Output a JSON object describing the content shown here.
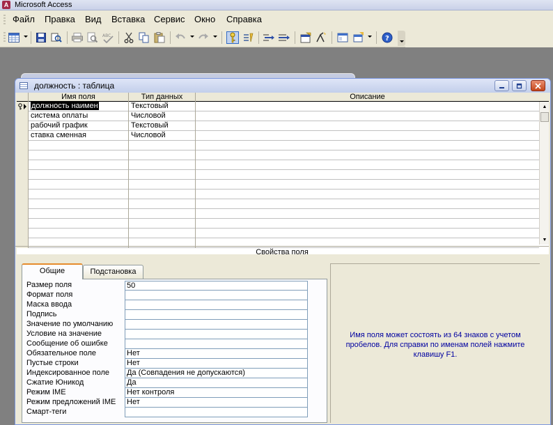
{
  "app": {
    "title": "Microsoft Access",
    "icon": "access-app-icon"
  },
  "menu": [
    {
      "label": "Файл"
    },
    {
      "label": "Правка"
    },
    {
      "label": "Вид"
    },
    {
      "label": "Вставка"
    },
    {
      "label": "Сервис"
    },
    {
      "label": "Окно"
    },
    {
      "label": "Справка"
    }
  ],
  "toolbar": {
    "buttons": [
      "view-icon",
      "save-icon",
      "search-db-icon",
      "print-icon",
      "print-preview-icon",
      "spelling-icon",
      "cut-icon",
      "copy-icon",
      "paste-icon",
      "undo-icon",
      "redo-icon",
      "primary-key-icon",
      "index-icon",
      "insert-rows-icon",
      "delete-rows-icon",
      "properties-icon",
      "build-icon",
      "database-window-icon",
      "new-object-icon",
      "help-icon"
    ]
  },
  "document": {
    "title": "должность : таблица",
    "columns": {
      "field_name": "Имя поля",
      "data_type": "Тип данных",
      "description": "Описание"
    },
    "rows": [
      {
        "field_name": "должность наимен",
        "data_type": "Текстовый",
        "description": "",
        "primary_key": true
      },
      {
        "field_name": "система оплаты",
        "data_type": "Числовой",
        "description": ""
      },
      {
        "field_name": "рабочий график",
        "data_type": "Текстовый",
        "description": ""
      },
      {
        "field_name": "ставка сменная",
        "data_type": "Числовой",
        "description": ""
      }
    ],
    "empty_row_count": 11,
    "field_properties_label": "Свойства поля",
    "tabs": [
      {
        "label": "Общие",
        "active": true
      },
      {
        "label": "Подстановка",
        "active": false
      }
    ],
    "properties": [
      {
        "label": "Размер поля",
        "value": "50"
      },
      {
        "label": "Формат поля",
        "value": ""
      },
      {
        "label": "Маска ввода",
        "value": ""
      },
      {
        "label": "Подпись",
        "value": ""
      },
      {
        "label": "Значение по умолчанию",
        "value": ""
      },
      {
        "label": "Условие на значение",
        "value": ""
      },
      {
        "label": "Сообщение об ошибке",
        "value": ""
      },
      {
        "label": "Обязательное поле",
        "value": "Нет"
      },
      {
        "label": "Пустые строки",
        "value": "Нет"
      },
      {
        "label": "Индексированное поле",
        "value": "Да (Совпадения не допускаются)"
      },
      {
        "label": "Сжатие Юникод",
        "value": "Да"
      },
      {
        "label": "Режим IME",
        "value": "Нет контроля"
      },
      {
        "label": "Режим предложений IME",
        "value": "Нет"
      },
      {
        "label": "Смарт-теги",
        "value": ""
      }
    ],
    "help_text": "Имя поля может состоять из 64 знаков с учетом пробелов.  Для справки по именам полей нажмите клавишу F1."
  },
  "colors": {
    "help_text": "#0000a0",
    "active_tab_accent": "#e68b2c",
    "close_button": "#c4471c",
    "workspace": "#808080"
  }
}
